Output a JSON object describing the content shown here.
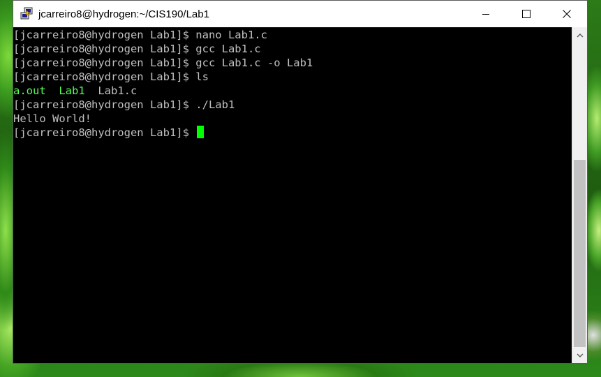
{
  "window": {
    "title": "jcarreiro8@hydrogen:~/CIS190/Lab1",
    "icon": "putty-icon"
  },
  "terminal": {
    "lines": [
      "[jcarreiro8@hydrogen Lab1]$ nano Lab1.c",
      "[jcarreiro8@hydrogen Lab1]$ gcc Lab1.c",
      "[jcarreiro8@hydrogen Lab1]$ gcc Lab1.c -o Lab1",
      "[jcarreiro8@hydrogen Lab1]$ ls"
    ],
    "ls_output": {
      "executable1": "a.out",
      "executable2": "Lab1",
      "file": "Lab1.c"
    },
    "lines2": [
      "[jcarreiro8@hydrogen Lab1]$ ./Lab1",
      "Hello World!"
    ],
    "prompt": "[jcarreiro8@hydrogen Lab1]$ ",
    "colors": {
      "background": "#000000",
      "text": "#c0c0c0",
      "executable": "#55ff55",
      "cursor": "#00ff00"
    }
  },
  "scrollbar": {
    "position_fraction": 1.0
  }
}
